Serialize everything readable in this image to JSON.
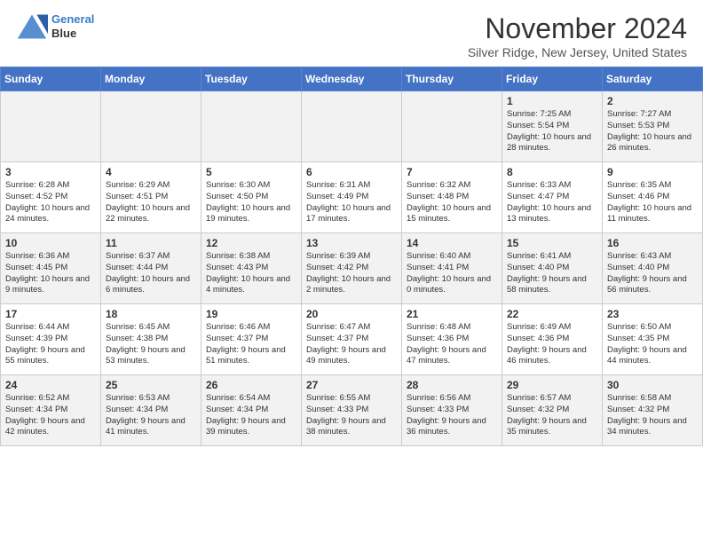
{
  "header": {
    "logo_line1": "General",
    "logo_line2": "Blue",
    "month": "November 2024",
    "location": "Silver Ridge, New Jersey, United States"
  },
  "weekdays": [
    "Sunday",
    "Monday",
    "Tuesday",
    "Wednesday",
    "Thursday",
    "Friday",
    "Saturday"
  ],
  "weeks": [
    [
      {
        "day": "",
        "info": ""
      },
      {
        "day": "",
        "info": ""
      },
      {
        "day": "",
        "info": ""
      },
      {
        "day": "",
        "info": ""
      },
      {
        "day": "",
        "info": ""
      },
      {
        "day": "1",
        "info": "Sunrise: 7:25 AM\nSunset: 5:54 PM\nDaylight: 10 hours and 28 minutes."
      },
      {
        "day": "2",
        "info": "Sunrise: 7:27 AM\nSunset: 5:53 PM\nDaylight: 10 hours and 26 minutes."
      }
    ],
    [
      {
        "day": "3",
        "info": "Sunrise: 6:28 AM\nSunset: 4:52 PM\nDaylight: 10 hours and 24 minutes."
      },
      {
        "day": "4",
        "info": "Sunrise: 6:29 AM\nSunset: 4:51 PM\nDaylight: 10 hours and 22 minutes."
      },
      {
        "day": "5",
        "info": "Sunrise: 6:30 AM\nSunset: 4:50 PM\nDaylight: 10 hours and 19 minutes."
      },
      {
        "day": "6",
        "info": "Sunrise: 6:31 AM\nSunset: 4:49 PM\nDaylight: 10 hours and 17 minutes."
      },
      {
        "day": "7",
        "info": "Sunrise: 6:32 AM\nSunset: 4:48 PM\nDaylight: 10 hours and 15 minutes."
      },
      {
        "day": "8",
        "info": "Sunrise: 6:33 AM\nSunset: 4:47 PM\nDaylight: 10 hours and 13 minutes."
      },
      {
        "day": "9",
        "info": "Sunrise: 6:35 AM\nSunset: 4:46 PM\nDaylight: 10 hours and 11 minutes."
      }
    ],
    [
      {
        "day": "10",
        "info": "Sunrise: 6:36 AM\nSunset: 4:45 PM\nDaylight: 10 hours and 9 minutes."
      },
      {
        "day": "11",
        "info": "Sunrise: 6:37 AM\nSunset: 4:44 PM\nDaylight: 10 hours and 6 minutes."
      },
      {
        "day": "12",
        "info": "Sunrise: 6:38 AM\nSunset: 4:43 PM\nDaylight: 10 hours and 4 minutes."
      },
      {
        "day": "13",
        "info": "Sunrise: 6:39 AM\nSunset: 4:42 PM\nDaylight: 10 hours and 2 minutes."
      },
      {
        "day": "14",
        "info": "Sunrise: 6:40 AM\nSunset: 4:41 PM\nDaylight: 10 hours and 0 minutes."
      },
      {
        "day": "15",
        "info": "Sunrise: 6:41 AM\nSunset: 4:40 PM\nDaylight: 9 hours and 58 minutes."
      },
      {
        "day": "16",
        "info": "Sunrise: 6:43 AM\nSunset: 4:40 PM\nDaylight: 9 hours and 56 minutes."
      }
    ],
    [
      {
        "day": "17",
        "info": "Sunrise: 6:44 AM\nSunset: 4:39 PM\nDaylight: 9 hours and 55 minutes."
      },
      {
        "day": "18",
        "info": "Sunrise: 6:45 AM\nSunset: 4:38 PM\nDaylight: 9 hours and 53 minutes."
      },
      {
        "day": "19",
        "info": "Sunrise: 6:46 AM\nSunset: 4:37 PM\nDaylight: 9 hours and 51 minutes."
      },
      {
        "day": "20",
        "info": "Sunrise: 6:47 AM\nSunset: 4:37 PM\nDaylight: 9 hours and 49 minutes."
      },
      {
        "day": "21",
        "info": "Sunrise: 6:48 AM\nSunset: 4:36 PM\nDaylight: 9 hours and 47 minutes."
      },
      {
        "day": "22",
        "info": "Sunrise: 6:49 AM\nSunset: 4:36 PM\nDaylight: 9 hours and 46 minutes."
      },
      {
        "day": "23",
        "info": "Sunrise: 6:50 AM\nSunset: 4:35 PM\nDaylight: 9 hours and 44 minutes."
      }
    ],
    [
      {
        "day": "24",
        "info": "Sunrise: 6:52 AM\nSunset: 4:34 PM\nDaylight: 9 hours and 42 minutes."
      },
      {
        "day": "25",
        "info": "Sunrise: 6:53 AM\nSunset: 4:34 PM\nDaylight: 9 hours and 41 minutes."
      },
      {
        "day": "26",
        "info": "Sunrise: 6:54 AM\nSunset: 4:34 PM\nDaylight: 9 hours and 39 minutes."
      },
      {
        "day": "27",
        "info": "Sunrise: 6:55 AM\nSunset: 4:33 PM\nDaylight: 9 hours and 38 minutes."
      },
      {
        "day": "28",
        "info": "Sunrise: 6:56 AM\nSunset: 4:33 PM\nDaylight: 9 hours and 36 minutes."
      },
      {
        "day": "29",
        "info": "Sunrise: 6:57 AM\nSunset: 4:32 PM\nDaylight: 9 hours and 35 minutes."
      },
      {
        "day": "30",
        "info": "Sunrise: 6:58 AM\nSunset: 4:32 PM\nDaylight: 9 hours and 34 minutes."
      }
    ]
  ]
}
